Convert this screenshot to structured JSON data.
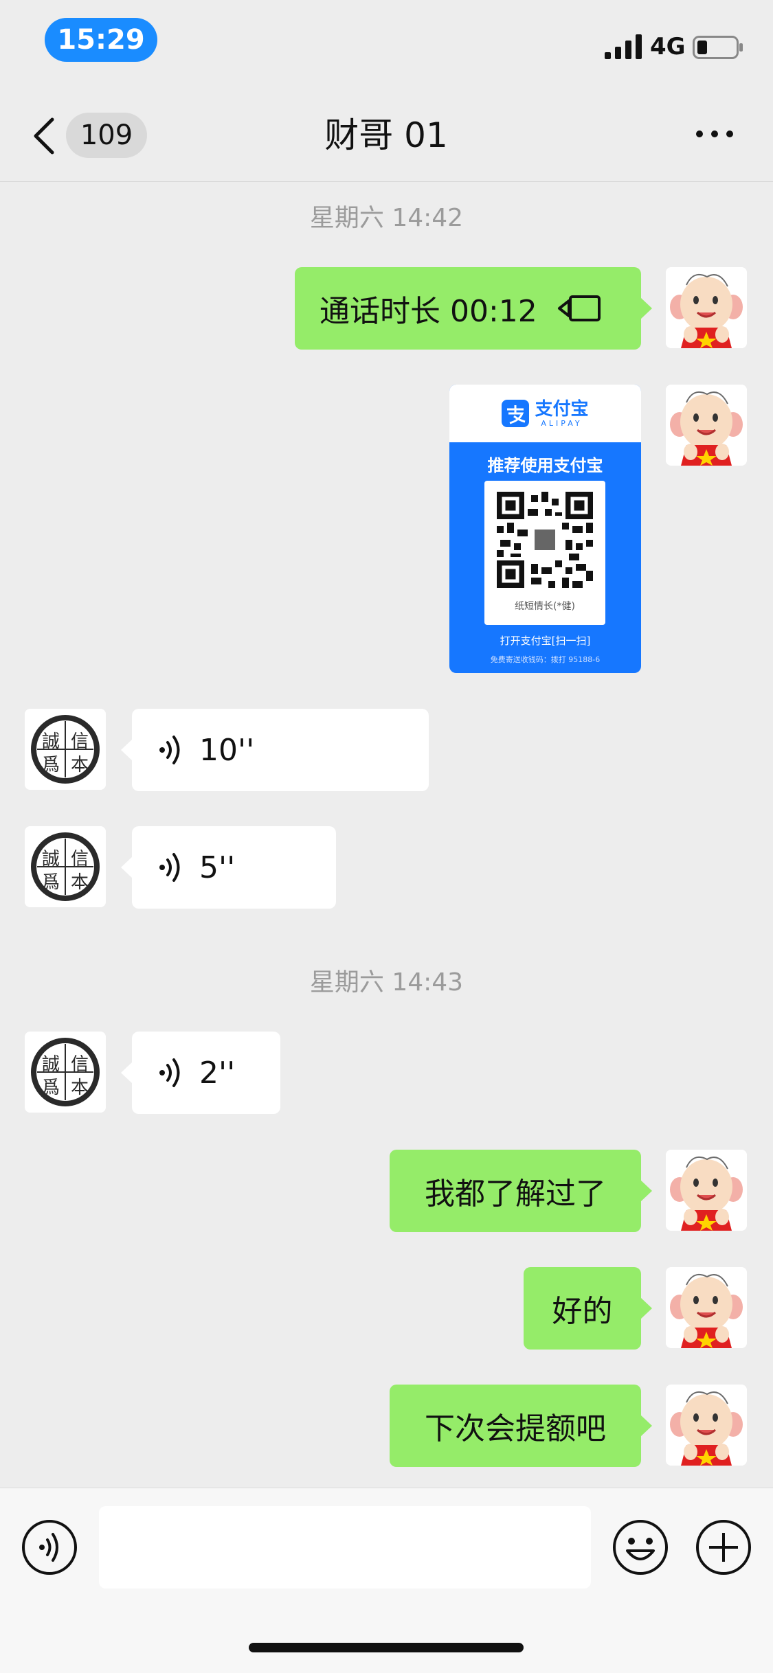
{
  "status_bar": {
    "time": "15:29",
    "network": "4G"
  },
  "header": {
    "unread_count": "109",
    "title": "财哥 01"
  },
  "timestamps": [
    "星期六 14:42",
    "星期六 14:43"
  ],
  "messages": [
    {
      "type": "call",
      "direction": "sent",
      "text": "通话时长 00:12"
    },
    {
      "type": "image",
      "direction": "sent"
    },
    {
      "type": "voice",
      "direction": "received",
      "duration": "10''"
    },
    {
      "type": "voice",
      "direction": "received",
      "duration": "5''"
    },
    {
      "type": "voice",
      "direction": "received",
      "duration": "2''"
    },
    {
      "type": "text",
      "direction": "sent",
      "text": "我都了解过了"
    },
    {
      "type": "text",
      "direction": "sent",
      "text": "好的"
    },
    {
      "type": "text",
      "direction": "sent",
      "text": "下次会提额吧"
    }
  ],
  "alipay_card": {
    "brand": "支付宝",
    "brand_en": "ALIPAY",
    "recommend": "推荐使用支付宝",
    "payee": "纸短情长(*健)",
    "open_hint": "打开支付宝[扫一扫]",
    "free_hint": "免费寄送收钱码：拨打 95188-6"
  },
  "avatar_seal_chars": [
    "誠",
    "信",
    "爲",
    "本"
  ],
  "input": {
    "placeholder": ""
  },
  "colors": {
    "sent_bubble": "#95ec69",
    "received_bubble": "#ffffff",
    "background": "#ededed",
    "alipay_blue": "#1677ff",
    "time_pill": "#1a8cff"
  },
  "icons": [
    "back-icon",
    "more-icon",
    "call-icon",
    "voice-icon",
    "voice-input-icon",
    "emoji-icon",
    "plus-icon"
  ]
}
